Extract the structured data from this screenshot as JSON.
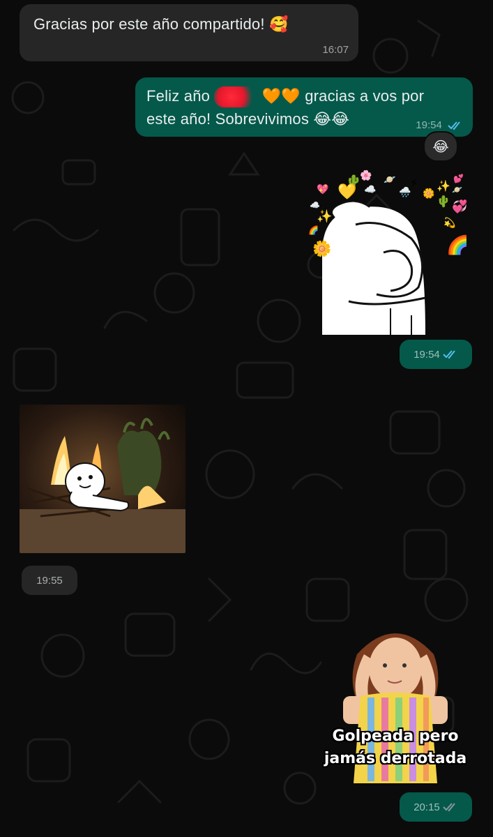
{
  "messages": [
    {
      "direction": "incoming",
      "text": "Gracias por este año compartido! 🥰",
      "time": "16:07"
    },
    {
      "direction": "outgoing",
      "text_before": "Feliz año",
      "text_after": "🧡🧡 gracias a vos por",
      "text_line2": "este año! Sobrevivimos 😂😂",
      "time": "19:54",
      "status": "read",
      "reaction": "😂"
    },
    {
      "direction": "outgoing",
      "type": "sticker",
      "time": "19:54",
      "status": "read"
    },
    {
      "direction": "incoming",
      "type": "image",
      "time": "19:55"
    },
    {
      "direction": "outgoing",
      "type": "sticker",
      "caption_line1": "Golpeada pero",
      "caption_line2": "jamás derrotada",
      "time": "20:15",
      "status": "delivered"
    }
  ],
  "colors": {
    "background": "#0b0b0b",
    "incoming": "#262626",
    "outgoing": "#04594a",
    "read_ticks": "#53bdeb",
    "delivered_ticks": "#8696a0"
  },
  "sticker1": {
    "decorations": [
      "🌵",
      "🌸",
      "💖",
      "💛",
      "☁️",
      "🪐",
      "⚡",
      "🌧️",
      "🌼",
      "✨",
      "🪐",
      "💕",
      "🌵",
      "✨",
      "💞",
      "🌈",
      "🌼",
      "🌈",
      "💫"
    ]
  }
}
